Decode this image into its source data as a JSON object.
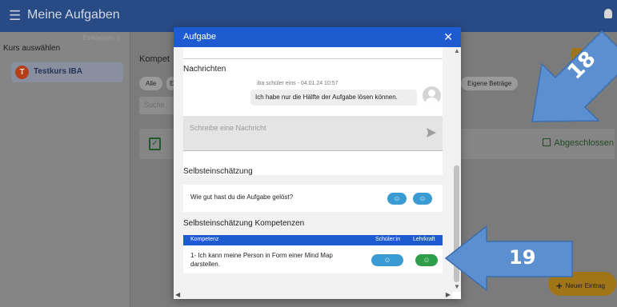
{
  "app": {
    "title": "Meine Aufgaben",
    "menu_icon": "hamburger-icon",
    "notification_icon": "bell-icon"
  },
  "sidebar": {
    "collapse_label": "Einklappen  <",
    "heading": "Kurs auswählen",
    "course": {
      "initial": "T",
      "name": "Testkurs IBA"
    }
  },
  "background": {
    "section_title": "Kompet",
    "chips": [
      "Alle",
      "E",
      "Eigene Beträge"
    ],
    "search_placeholder": "Suche",
    "status_label": "Abgeschlossen",
    "new_entry_label": "Neuer Eintrag"
  },
  "modal": {
    "title": "Aufgabe",
    "close_symbol": "✕",
    "messages": {
      "heading": "Nachrichten",
      "items": [
        {
          "meta": "iba schüler eins - 04.01.24 10:57",
          "text": "Ich habe nur die Hälfte der Aufgabe lösen können."
        }
      ],
      "input_placeholder": "Schreibe eine Nachricht"
    },
    "self_assessment": {
      "heading": "Selbsteinschätzung",
      "question": "Wie gut hast du die Aufgabe gelöst?",
      "face_symbol": "☺"
    },
    "competences": {
      "heading": "Selbsteinschätzung Kompetenzen",
      "columns": [
        "Kompetenz",
        "Schüler:in",
        "Lehrkraft"
      ],
      "rows": [
        {
          "text": "1- Ich kann meine Person in Form einer Mind Map darstellen.",
          "student": "☺",
          "teacher": "☺"
        }
      ]
    }
  },
  "annotations": {
    "arrow_18": "18",
    "arrow_19": "19",
    "color": "#5b8fcf"
  }
}
